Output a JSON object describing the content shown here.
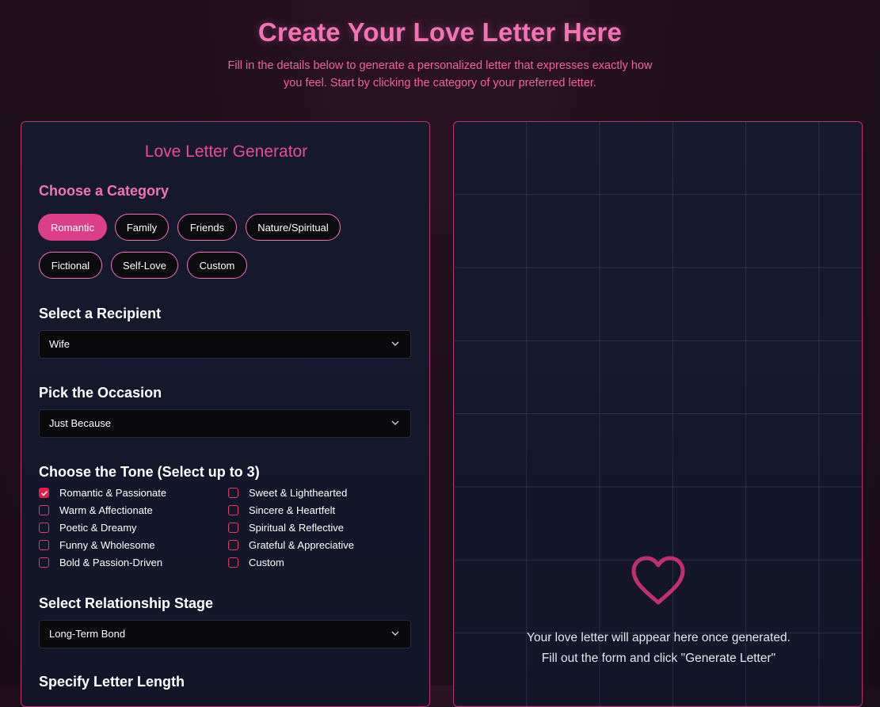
{
  "header": {
    "title": "Create Your Love Letter Here",
    "subtitle": "Fill in the details below to generate a personalized letter that expresses exactly how you feel. Start by clicking the category of your preferred letter."
  },
  "form": {
    "title": "Love Letter Generator",
    "category_label": "Choose a Category",
    "categories": [
      "Romantic",
      "Family",
      "Friends",
      "Nature/Spiritual",
      "Fictional",
      "Self-Love",
      "Custom"
    ],
    "selected_category": "Romantic",
    "recipient_label": "Select a Recipient",
    "recipient_value": "Wife",
    "occasion_label": "Pick the Occasion",
    "occasion_value": "Just Because",
    "tone_label": "Choose the Tone (Select up to 3)",
    "tones": [
      {
        "label": "Romantic & Passionate",
        "checked": true
      },
      {
        "label": "Sweet & Lighthearted",
        "checked": false
      },
      {
        "label": "Warm & Affectionate",
        "checked": false
      },
      {
        "label": "Sincere & Heartfelt",
        "checked": false
      },
      {
        "label": "Poetic & Dreamy",
        "checked": false
      },
      {
        "label": "Spiritual & Reflective",
        "checked": false
      },
      {
        "label": "Funny & Wholesome",
        "checked": false
      },
      {
        "label": "Grateful & Appreciative",
        "checked": false
      },
      {
        "label": "Bold & Passion-Driven",
        "checked": false
      },
      {
        "label": "Custom",
        "checked": false
      }
    ],
    "stage_label": "Select Relationship Stage",
    "stage_value": "Long-Term Bond",
    "length_label": "Specify Letter Length"
  },
  "preview": {
    "line1": "Your love letter will appear here once generated.",
    "line2": "Fill out the form and click \"Generate Letter\""
  },
  "colors": {
    "accent": "#ec4899",
    "active_chip": "#db3f8a",
    "checkbox": "#e11d48",
    "background": "#1f0f1b",
    "panel": "#15182d"
  }
}
